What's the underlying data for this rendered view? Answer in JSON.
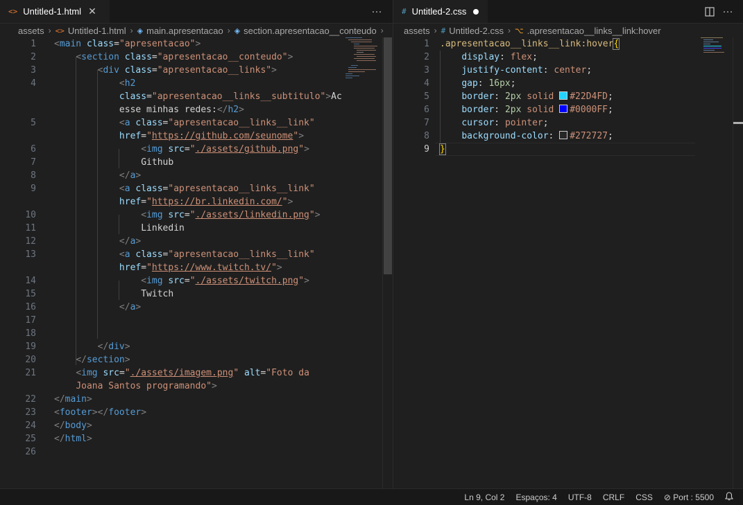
{
  "left": {
    "tab": {
      "title": "Untitled-1.html",
      "icon": "<>",
      "more": "···"
    },
    "breadcrumb": [
      "assets",
      "Untitled-1.html",
      "main.apresentacao",
      "section.apresentacao__conteudo"
    ]
  },
  "right": {
    "tab": {
      "title": "Untitled-2.css",
      "icon": "#"
    },
    "breadcrumb": [
      "assets",
      "Untitled-2.css",
      ".apresentacao__links__link:hover"
    ],
    "colors": {
      "c1": "#22D4FD",
      "c2": "#0000FF",
      "c3": "#272727"
    }
  },
  "status": {
    "position": "Ln 9, Col 2",
    "spaces": "Espaços: 4",
    "encoding": "UTF-8",
    "eol": "CRLF",
    "language": "CSS",
    "port": "Port : 5500"
  }
}
